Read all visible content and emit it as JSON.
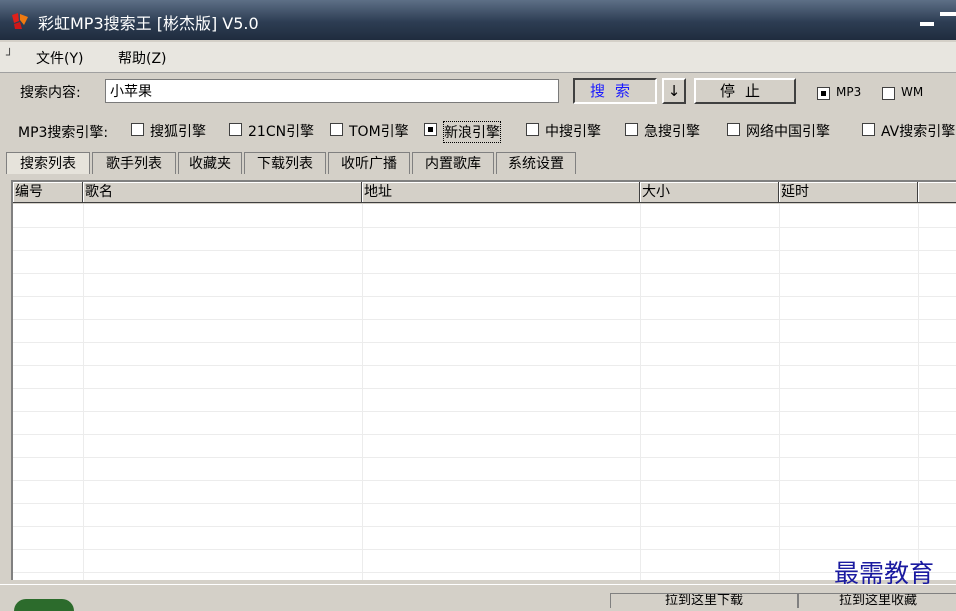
{
  "window": {
    "title": "彩虹MP3搜索王 [彬杰版] V5.0"
  },
  "menu": {
    "grip": "┘",
    "file": "文件(Y)",
    "help": "帮助(Z)"
  },
  "search": {
    "label": "搜索内容:",
    "value": "小苹果",
    "search_button": "搜索",
    "arrow_button": "↓",
    "stop_button": "停止",
    "format_mp3": "MP3",
    "format_mp3_checked": true,
    "format_wm": "WM",
    "format_wm_checked": false
  },
  "engines": {
    "label": "MP3搜索引擎:",
    "items": [
      {
        "label": "搜狐引擎",
        "checked": false
      },
      {
        "label": "21CN引擎",
        "checked": false
      },
      {
        "label": "TOM引擎",
        "checked": false
      },
      {
        "label": "新浪引擎",
        "checked": true
      },
      {
        "label": "中搜引擎",
        "checked": false
      },
      {
        "label": "急搜引擎",
        "checked": false
      },
      {
        "label": "网络中国引擎",
        "checked": false
      },
      {
        "label": "AV搜索引擎",
        "checked": false
      }
    ]
  },
  "tabs": [
    "搜索列表",
    "歌手列表",
    "收藏夹",
    "下载列表",
    "收听广播",
    "内置歌库",
    "系统设置"
  ],
  "table": {
    "columns": [
      "编号",
      "歌名",
      "地址",
      "大小",
      "延时"
    ]
  },
  "status": {
    "button1": "拉到这里下载",
    "button2": "拉到这里收藏"
  },
  "watermark": "最需教育",
  "colors": {
    "titlebar": "#2d3d53",
    "search_button_text": "#1a1aff",
    "watermark": "#1a1aa0"
  }
}
